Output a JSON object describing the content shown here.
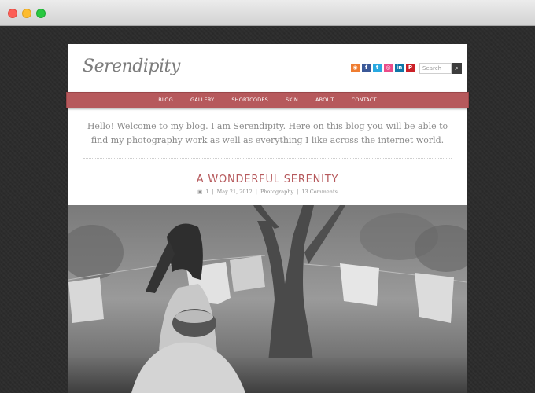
{
  "site": {
    "logo": "Serendipity",
    "search_placeholder": "Search",
    "search_button": "⌕",
    "social_icons": [
      "rss-icon",
      "facebook-icon",
      "twitter-icon",
      "dribbble-icon",
      "linkedin-icon",
      "pinterest-icon"
    ],
    "social_glyphs": [
      "◉",
      "f",
      "t",
      "◎",
      "in",
      "P"
    ]
  },
  "nav": {
    "items": [
      "Blog",
      "Gallery",
      "Shortcodes",
      "Skin",
      "About",
      "Contact"
    ]
  },
  "intro": {
    "text": "Hello! Welcome to my blog. I am Serendipity. Here on this blog you will be able to find my photography work as well as everything I like across the internet world."
  },
  "post": {
    "title": "A Wonderful Serenity",
    "meta": {
      "number": "1",
      "date": "May 21, 2012",
      "category": "Photography",
      "comments": "13 Comments"
    }
  },
  "colors": {
    "accent": "#b6595c",
    "window_bg": "#2e2e2e"
  }
}
